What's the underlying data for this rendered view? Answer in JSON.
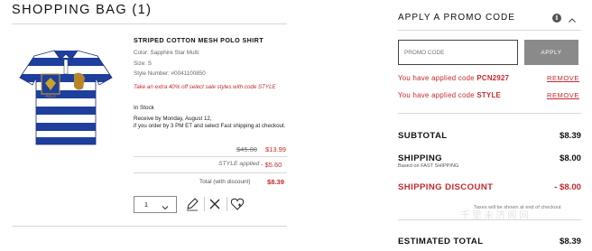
{
  "bag": {
    "title": "SHOPPING BAG (1)",
    "item": {
      "name": "STRIPED COTTON MESH POLO SHIRT",
      "color": "Color: Sapphire Star Multi",
      "size": "Size: S",
      "style_number": "Style Number: #0041100850",
      "promo_message": "Take an extra 40% off select sale styles with code STYLE",
      "stock_status": "In Stock",
      "receive_by": "Receive by Monday, August 12,",
      "shipping_note": "if you order by 3 PM ET and select Fast shipping at checkout.",
      "original_price": "$45.00",
      "sale_price": "$13.99",
      "style_applied_label": "STYLE applied",
      "style_discount": "- $5.60",
      "total_label": "Total (with discount)",
      "total_value": "$8.39",
      "quantity": "1",
      "image_logo_text": "POLO"
    }
  },
  "promo": {
    "title": "APPLY A PROMO CODE",
    "input_placeholder": "PROMO CODE",
    "apply_label": "APPLY",
    "applied": [
      {
        "prefix": "You have applied code ",
        "code": "PCN2927",
        "remove_label": "REMOVE"
      },
      {
        "prefix": "You have applied code ",
        "code": "STYLE",
        "remove_label": "REMOVE"
      }
    ]
  },
  "summary": {
    "subtotal_label": "SUBTOTAL",
    "subtotal_value": "$8.39",
    "shipping_label": "SHIPPING",
    "shipping_value": "$8.00",
    "shipping_note": "Based on FAST SHIPPING",
    "shipping_discount_label": "SHIPPING DISCOUNT",
    "shipping_discount_value": "- $8.00",
    "tax_note": "Taxes will be shown at end of checkout",
    "estimated_total_label": "ESTIMATED TOTAL",
    "estimated_total_value": "$8.39"
  },
  "watermark_text": "千里未济阁网",
  "colors": {
    "accent_red": "#c8282d",
    "shirt_blue": "#1f3f9e",
    "apply_button_gray": "#8a8a8a"
  },
  "icons": [
    "chevron-down-icon",
    "edit-pencil-icon",
    "close-icon",
    "wishlist-heart-icon",
    "info-icon",
    "chevron-up-icon"
  ]
}
